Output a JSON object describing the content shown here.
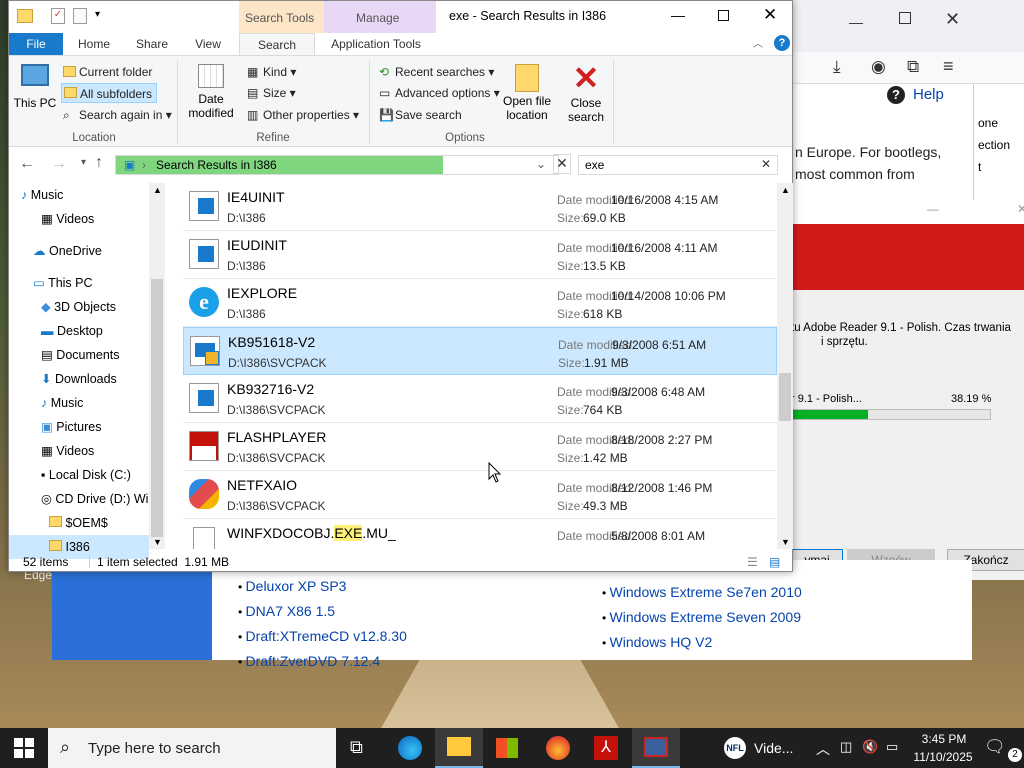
{
  "explorer": {
    "title": "exe - Search Results in I386",
    "tabs": {
      "file": "File",
      "home": "Home",
      "share": "Share",
      "view": "View",
      "search": "Search",
      "search_tools": "Search Tools",
      "manage": "Manage",
      "app_tools": "Application Tools"
    },
    "ribbon": {
      "this_pc": "This PC",
      "current_folder": "Current folder",
      "all_subfolders": "All subfolders",
      "search_again": "Search again in",
      "location_group": "Location",
      "date_modified": "Date modified",
      "kind": "Kind",
      "size": "Size",
      "other_props": "Other properties",
      "refine_group": "Refine",
      "recent_searches": "Recent searches",
      "advanced_options": "Advanced options",
      "save_search": "Save search",
      "open_location": "Open file location",
      "close_search": "Close search",
      "options_group": "Options"
    },
    "address": "Search Results in I386",
    "search_value": "exe",
    "nav_items": [
      "Music",
      "Videos",
      "OneDrive",
      "This PC",
      "3D Objects",
      "Desktop",
      "Documents",
      "Downloads",
      "Music",
      "Pictures",
      "Videos",
      "Local Disk (C:)",
      "CD Drive (D:) Wi",
      "$OEM$",
      "I386"
    ],
    "date_label": "Date modified:",
    "size_label": "Size:",
    "files": [
      {
        "name": "IE4UINIT",
        "path": "D:\\I386",
        "date": "10/16/2008 4:15 AM",
        "size": "69.0 KB",
        "icon": "app-icon"
      },
      {
        "name": "IEUDINIT",
        "path": "D:\\I386",
        "date": "10/16/2008 4:11 AM",
        "size": "13.5 KB",
        "icon": "app-icon"
      },
      {
        "name": "IEXPLORE",
        "path": "D:\\I386",
        "date": "10/14/2008 10:06 PM",
        "size": "618 KB",
        "icon": "ie-icon"
      },
      {
        "name": "KB951618-V2",
        "path": "D:\\I386\\SVCPACK",
        "date": "9/3/2008 6:51 AM",
        "size": "1.91 MB",
        "icon": "installer-icon"
      },
      {
        "name": "KB932716-V2",
        "path": "D:\\I386\\SVCPACK",
        "date": "9/3/2008 6:48 AM",
        "size": "764 KB",
        "icon": "app-icon"
      },
      {
        "name": "FLASHPLAYER",
        "path": "D:\\I386\\SVCPACK",
        "date": "8/18/2008 2:27 PM",
        "size": "1.42 MB",
        "icon": "flash-icon"
      },
      {
        "name": "NETFXAIO",
        "path": "D:\\I386\\SVCPACK",
        "date": "8/12/2008 1:46 PM",
        "size": "49.3 MB",
        "icon": "netfx-icon"
      }
    ],
    "last_file": {
      "pre": "WINFXDOCOBJ.",
      "hl": "EXE",
      "post": ".MU_",
      "date": "5/8/2008 8:01 AM"
    },
    "status_count": "52 items",
    "status_selected": "1 item selected  1.91 MB"
  },
  "browser": {
    "help": "Help",
    "text1": "n Europe. For bootlegs,",
    "text2": "most common from",
    "side1": "one",
    "side2": "ection",
    "side3": "t"
  },
  "installer": {
    "text1": "tu Adobe Reader 9.1 - Polish. Czas trwania",
    "text2": "i sprzętu.",
    "progress_label": "r 9.1 - Polish...",
    "progress_pct": "38.19 %",
    "progress_value": 0.3819,
    "btn1": "ymaj",
    "btn2": "Wznów",
    "btn3": "Zakończ"
  },
  "webpage": {
    "left_links": [
      "Deluxor XP SP3",
      "DNA7 X86 1.5",
      "Draft:XTremeCD v12.8.30",
      "Draft:ZverDVD 7.12.4"
    ],
    "right_links": [
      "Windows Extreme Se7en 2010",
      "Windows Extreme Seven 2009",
      "Windows HQ V2"
    ],
    "edge_label": "Edge"
  },
  "taskbar": {
    "search_placeholder": "Type here to search",
    "video_label": "Vide...",
    "time": "3:45 PM",
    "date": "11/10/2025",
    "notif_count": "2"
  }
}
